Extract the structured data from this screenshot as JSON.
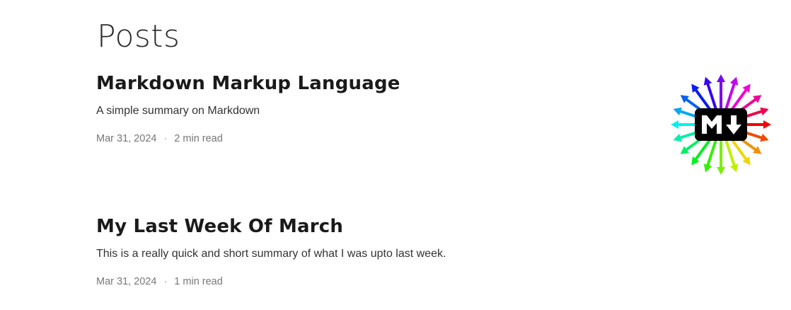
{
  "page": {
    "title": "Posts"
  },
  "posts": [
    {
      "title": "Markdown Markup Language",
      "summary": "A simple summary on Markdown",
      "date": "Mar 31, 2024",
      "separator": "·",
      "read_time": "2 min read",
      "image_icon": "markdown-logo-icon"
    },
    {
      "title": "My Last Week Of March",
      "summary": "This is a really quick and short summary of what I was upto last week.",
      "date": "Mar 31, 2024",
      "separator": "·",
      "read_time": "1 min read"
    }
  ],
  "colors": {
    "title": "#2b2b2b",
    "post_title": "#1a1a1a",
    "meta": "#777777",
    "logo_box": "#000000"
  }
}
